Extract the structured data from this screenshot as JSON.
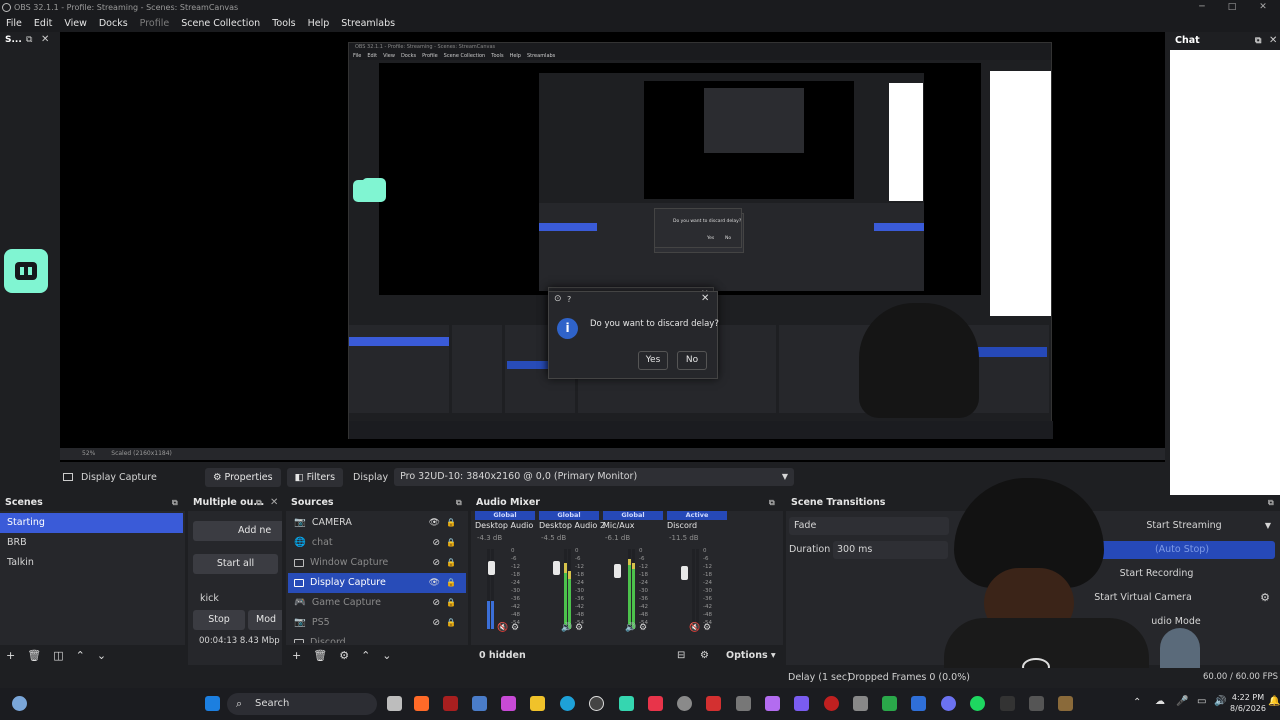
{
  "window": {
    "title": "OBS 32.1.1 - Profile: Streaming - Scenes: StreamCanvas",
    "minimize": "─",
    "maximize": "□",
    "close": "✕"
  },
  "menu": [
    "File",
    "Edit",
    "View",
    "Docks",
    "Profile",
    "Scene Collection",
    "Tools",
    "Help",
    "Streamlabs"
  ],
  "left_dock": {
    "title": "S..."
  },
  "chat_dock": {
    "title": "Chat"
  },
  "preview": {
    "scaled_text": "Scaled (2160x1184)",
    "zoom": "52%",
    "nested_title": "OBS 32.1.1 - Profile: Streaming - Scenes: StreamCanvas",
    "nested_menu": [
      "File",
      "Edit",
      "View",
      "Docks",
      "Profile",
      "Scene Collection",
      "Tools",
      "Help",
      "Streamlabs"
    ]
  },
  "dialog": {
    "title": "?",
    "message": "Do you want to discard delay?",
    "yes": "Yes",
    "no": "No",
    "small_message": "Do you want to discard delay?",
    "small_yes": "Yes",
    "small_no": "No"
  },
  "source_toolbar": {
    "selected": "Display Capture",
    "properties": "Properties",
    "filters": "Filters",
    "display_label": "Display",
    "display_value": "Pro 32UD-10: 3840x2160 @ 0,0 (Primary Monitor)"
  },
  "scenes": {
    "title": "Scenes",
    "items": [
      "Starting",
      "BRB",
      "Talkin"
    ]
  },
  "multiple_output": {
    "title": "Multiple ou...",
    "add_new": "Add ne",
    "start_all": "Start all",
    "target": "kick",
    "stop": "Stop",
    "modify": "Mod",
    "time": "00:04:13",
    "rate": "8.43 Mbp"
  },
  "sources": {
    "title": "Sources",
    "items": [
      {
        "name": "CAMERA",
        "icon": "camera-icon",
        "visible": true
      },
      {
        "name": "chat",
        "icon": "browser-icon",
        "visible": false
      },
      {
        "name": "Window Capture",
        "icon": "window-icon",
        "visible": false
      },
      {
        "name": "Display Capture",
        "icon": "monitor-icon",
        "visible": true
      },
      {
        "name": "Game Capture",
        "icon": "gamepad-icon",
        "visible": false
      },
      {
        "name": "PS5",
        "icon": "camera-icon",
        "visible": false
      },
      {
        "name": "Discord",
        "icon": "window-icon",
        "visible": false
      }
    ]
  },
  "audio_mixer": {
    "title": "Audio Mixer",
    "hidden": "0 hidden",
    "options": "Options",
    "channels": [
      {
        "tag": "Global",
        "name": "Desktop Audio",
        "db": "-4.3 dB",
        "level": 0.35
      },
      {
        "tag": "Global",
        "name": "Desktop Audio 2",
        "db": "-4.5 dB",
        "level": 0.7
      },
      {
        "tag": "Global",
        "name": "Mic/Aux",
        "db": "-6.1 dB",
        "level": 0.8
      },
      {
        "tag": "Active",
        "name": "Discord",
        "db": "-11.5 dB",
        "level": 0.0
      }
    ],
    "scale": [
      "0",
      "-6",
      "-12",
      "-18",
      "-24",
      "-30",
      "-36",
      "-42",
      "-48",
      "-54",
      "-60"
    ]
  },
  "scene_transitions": {
    "title": "Scene Transitions",
    "transition": "Fade",
    "duration_label": "Duration",
    "duration_value": "300 ms"
  },
  "controls": {
    "start_streaming": "Start Streaming",
    "auto_stop": "(Auto Stop)",
    "start_recording": "Start Recording",
    "start_virtual_camera": "Start Virtual Camera",
    "studio_mode": "udio Mode"
  },
  "status": {
    "delay": "Delay (1 sec)",
    "dropped": "Dropped Frames 0 (0.0%)",
    "fps": "60.00 / 60.00 FPS"
  },
  "taskbar": {
    "search": "Search",
    "time": "4:22 PM",
    "date": "8/6/2026"
  },
  "colors": {
    "accent": "#3a5bd8",
    "background": "#1e1f22",
    "panel": "#26272b",
    "streamlabs_green": "#80f5d2"
  }
}
